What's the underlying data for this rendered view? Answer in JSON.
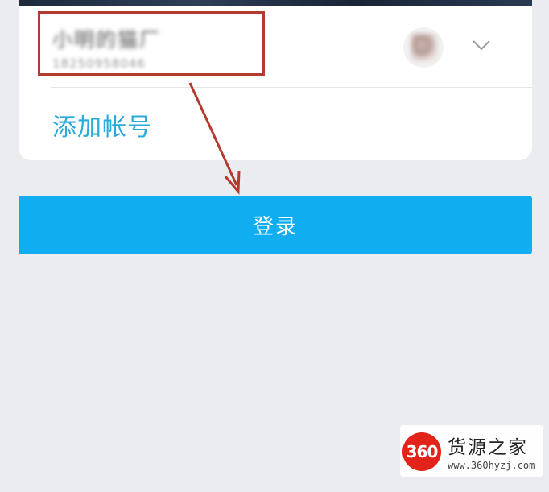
{
  "account": {
    "name": "小明的猫厂",
    "number": "18250958046"
  },
  "add_account_label": "添加帐号",
  "login_label": "登录",
  "colors": {
    "accent": "#10aef0",
    "link": "#29aadd",
    "annotation": "#b23a2e",
    "background": "#ebecef"
  },
  "icons": {
    "chevron": "chevron-down-icon",
    "avatar": "avatar"
  },
  "watermark": {
    "logo_text": "360",
    "title": "货源之家",
    "url": "www.360hyzj.com"
  }
}
